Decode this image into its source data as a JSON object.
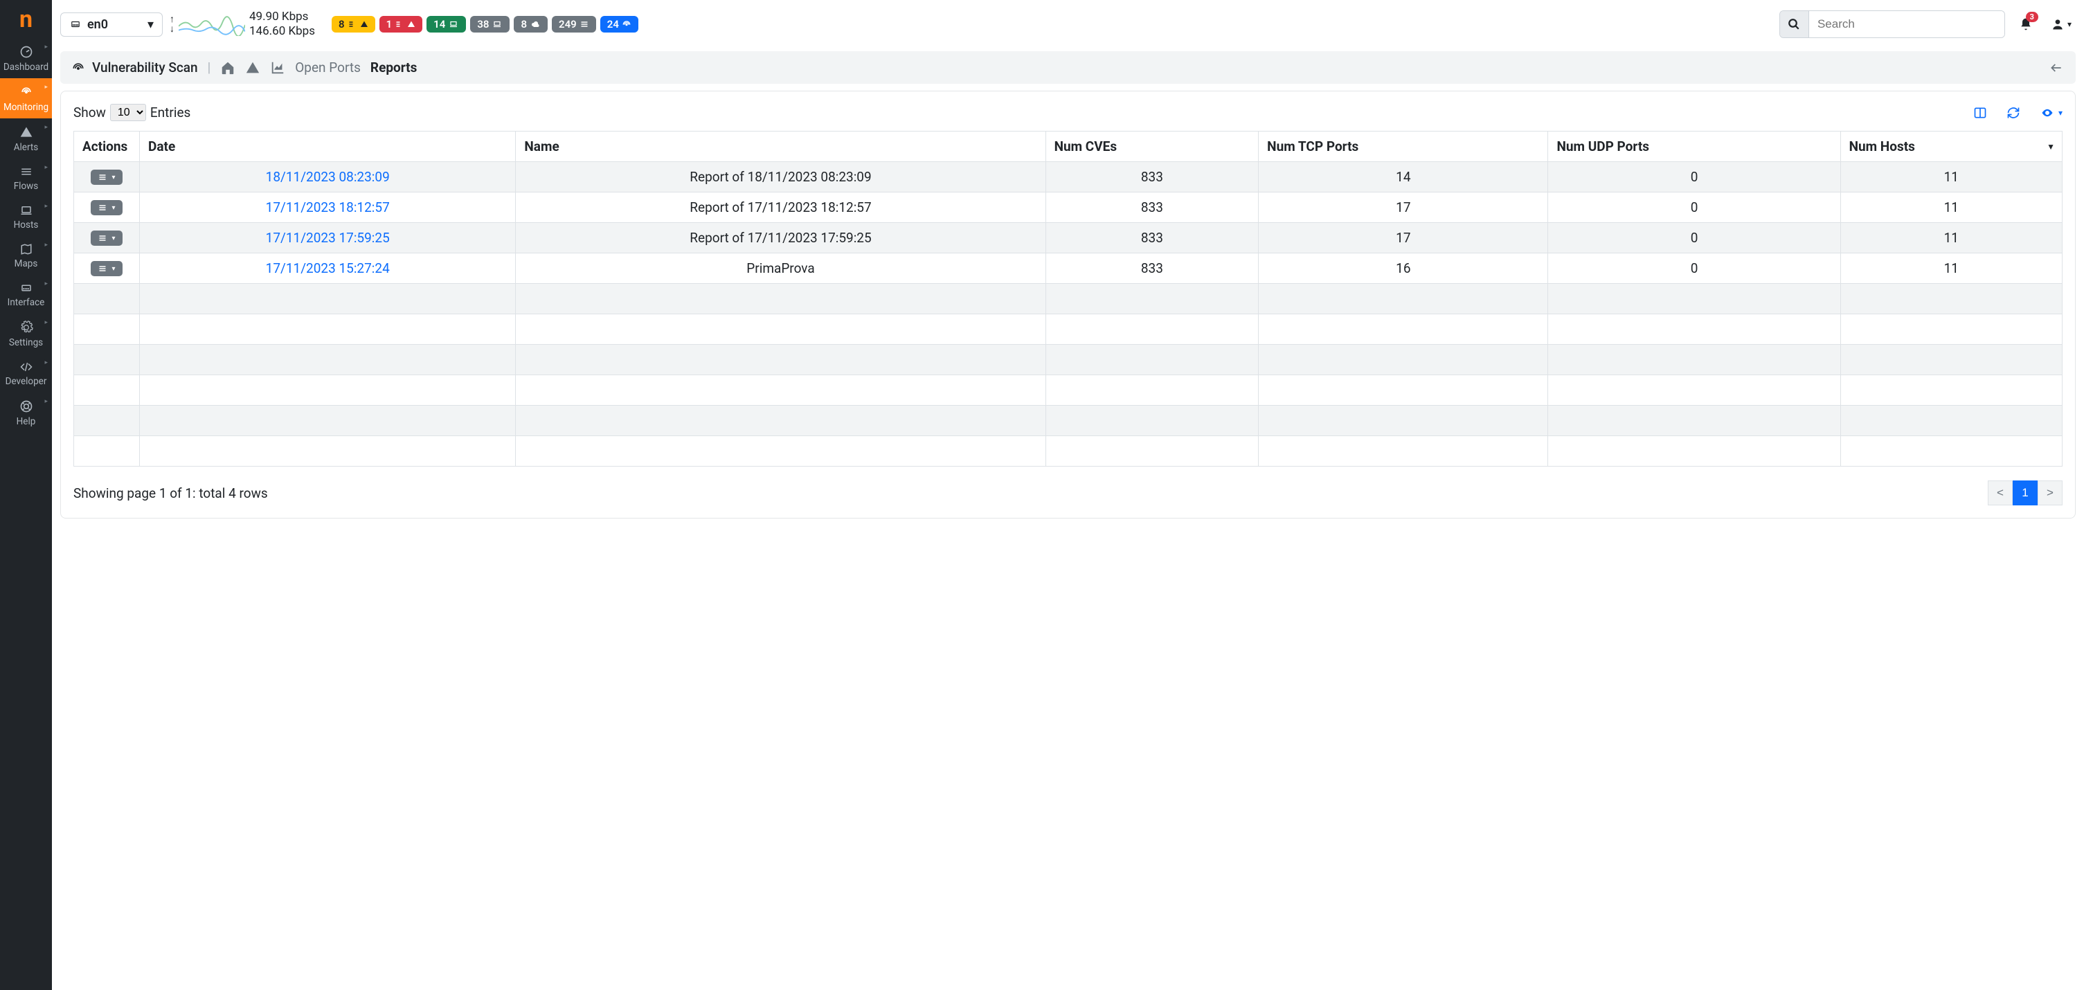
{
  "sidebar": {
    "items": [
      {
        "label": "Dashboard"
      },
      {
        "label": "Monitoring"
      },
      {
        "label": "Alerts"
      },
      {
        "label": "Flows"
      },
      {
        "label": "Hosts"
      },
      {
        "label": "Maps"
      },
      {
        "label": "Interface"
      },
      {
        "label": "Settings"
      },
      {
        "label": "Developer"
      },
      {
        "label": "Help"
      }
    ]
  },
  "topbar": {
    "interface": "en0",
    "throughput_up": "49.90 Kbps",
    "throughput_down": "146.60 Kbps",
    "badges": [
      {
        "text": "8",
        "color": "yellow",
        "icon": "list-warn"
      },
      {
        "text": "1",
        "color": "red",
        "icon": "list-warn"
      },
      {
        "text": "14",
        "color": "green",
        "icon": "laptop"
      },
      {
        "text": "38",
        "color": "gray",
        "icon": "laptop"
      },
      {
        "text": "8",
        "color": "gray",
        "icon": "cloud"
      },
      {
        "text": "249",
        "color": "gray",
        "icon": "list"
      },
      {
        "text": "24",
        "color": "blue",
        "icon": "radar"
      }
    ],
    "search_placeholder": "Search",
    "notif_count": "3"
  },
  "breadcrumb": {
    "title": "Vulnerability Scan",
    "tabs": {
      "open_ports": "Open Ports",
      "reports": "Reports"
    }
  },
  "table": {
    "show_label": "Show",
    "entries_label": "Entries",
    "page_size": "10",
    "columns": [
      "Actions",
      "Date",
      "Name",
      "Num CVEs",
      "Num TCP Ports",
      "Num UDP Ports",
      "Num Hosts"
    ],
    "rows": [
      {
        "date": "18/11/2023 08:23:09",
        "name": "Report of 18/11/2023 08:23:09",
        "cves": "833",
        "tcp": "14",
        "udp": "0",
        "hosts": "11"
      },
      {
        "date": "17/11/2023 18:12:57",
        "name": "Report of 17/11/2023 18:12:57",
        "cves": "833",
        "tcp": "17",
        "udp": "0",
        "hosts": "11"
      },
      {
        "date": "17/11/2023 17:59:25",
        "name": "Report of 17/11/2023 17:59:25",
        "cves": "833",
        "tcp": "17",
        "udp": "0",
        "hosts": "11"
      },
      {
        "date": "17/11/2023 15:27:24",
        "name": "PrimaProva",
        "cves": "833",
        "tcp": "16",
        "udp": "0",
        "hosts": "11"
      }
    ],
    "empty_rows": 6,
    "footer": "Showing page 1 of 1: total 4 rows",
    "pager": {
      "prev": "<",
      "page": "1",
      "next": ">"
    }
  }
}
